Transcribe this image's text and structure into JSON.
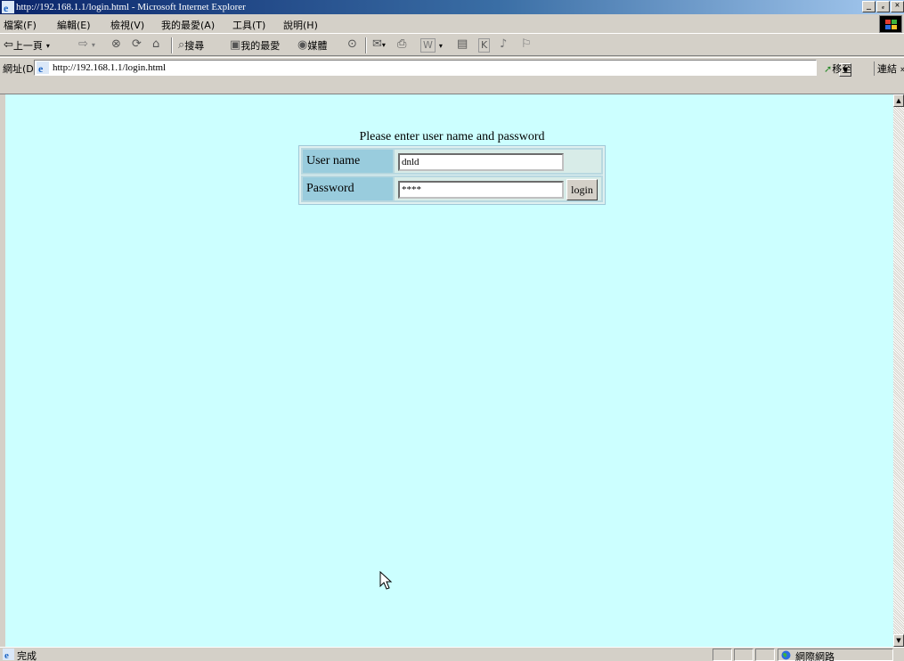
{
  "window": {
    "title": "http://192.168.1.1/login.html - Microsoft Internet Explorer",
    "controls": {
      "minimize": "_",
      "restore": "ₑ",
      "close": "×"
    }
  },
  "menu": {
    "items": [
      "檔案(F)",
      "編輯(E)",
      "檢視(V)",
      "我的最愛(A)",
      "工具(T)",
      "說明(H)"
    ]
  },
  "toolbar": {
    "back": "上一頁",
    "back_arrow": "⇦",
    "forward_arrow": "⇨",
    "stop": "⊗",
    "refresh": "⟳",
    "home": "⌂",
    "search": "搜尋",
    "favorites": "我的最愛",
    "media": "媒體",
    "history": "⊙",
    "mail": "✉",
    "print": "⎙",
    "edit": "W",
    "discuss": "▤",
    "messenger": "K",
    "extra1": "♪",
    "extra2": "⚐"
  },
  "address": {
    "label": "網址(D)",
    "url": "http://192.168.1.1/login.html",
    "dropdown": "▼",
    "go": "移至",
    "links": "連結 »"
  },
  "login": {
    "caption": "Please enter user name and password",
    "username_label": "User name",
    "username_value": "dnld",
    "password_label": "Password",
    "password_value": "****",
    "login_button": "login"
  },
  "scrollbar": {
    "up": "▲",
    "down": "▼"
  },
  "status": {
    "text": "完成",
    "zone": "網際網路"
  },
  "colors": {
    "page_background": "#ccffff",
    "label_cell": "#99ccdd",
    "titlebar_start": "#0a246a"
  }
}
